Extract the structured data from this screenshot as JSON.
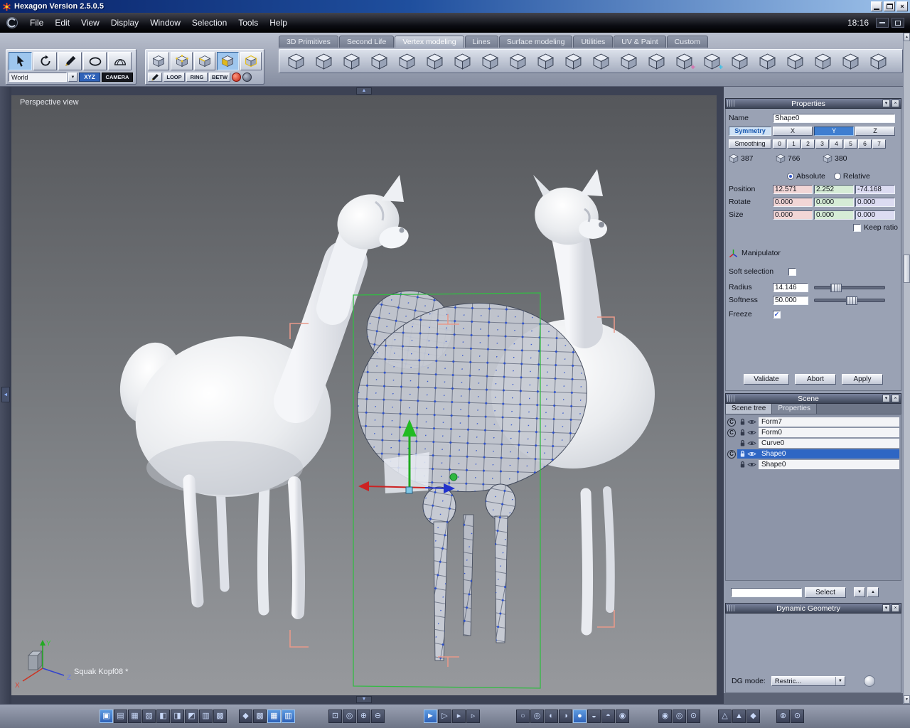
{
  "window": {
    "title": "Hexagon Version 2.5.0.5",
    "clock": "18:16"
  },
  "menu": {
    "items": [
      "File",
      "Edit",
      "View",
      "Display",
      "Window",
      "Selection",
      "Tools",
      "Help"
    ]
  },
  "tabs": {
    "items": [
      "3D Primitives",
      "Second Life",
      "Vertex modeling",
      "Lines",
      "Surface modeling",
      "Utilities",
      "UV & Paint",
      "Custom"
    ],
    "active_index": 2
  },
  "toolbars": {
    "world_selector": "World",
    "xyz_button": "XYZ",
    "camera_button": "CAMERA",
    "loop_button": "LOOP",
    "ring_button": "RING",
    "betw_button": "BETW"
  },
  "viewport": {
    "view_label": "Perspective view",
    "status_text": "Squak Kopf08 *",
    "axis_labels": {
      "x": "X",
      "y": "Y",
      "z": "Z"
    }
  },
  "properties_panel": {
    "title": "Properties",
    "name_label": "Name",
    "name_value": "Shape0",
    "symmetry_button": "Symmetry",
    "axis_buttons": [
      "X",
      "Y",
      "Z"
    ],
    "active_symmetry_axis": "Y",
    "smoothing_button": "Smoothing",
    "smoothing_levels": [
      "0",
      "1",
      "2",
      "3",
      "4",
      "5",
      "6",
      "7"
    ],
    "counts": {
      "vertices": "387",
      "edges": "766",
      "faces": "380"
    },
    "absolute_label": "Absolute",
    "relative_label": "Relative",
    "coordinate_mode": "Absolute",
    "position_label": "Position",
    "position": [
      "12.571",
      "2.252",
      "-74.168"
    ],
    "rotate_label": "Rotate",
    "rotate": [
      "0.000",
      "0.000",
      "0.000"
    ],
    "size_label": "Size",
    "size": [
      "0.000",
      "0.000",
      "0.000"
    ],
    "keep_ratio_label": "Keep ratio",
    "keep_ratio_checked": false,
    "manipulator_label": "Manipulator",
    "soft_selection_label": "Soft selection",
    "soft_selection_checked": false,
    "radius_label": "Radius",
    "radius_value": "14.146",
    "softness_label": "Softness",
    "softness_value": "50.000",
    "freeze_label": "Freeze",
    "freeze_checked": true,
    "validate_button": "Validate",
    "abort_button": "Abort",
    "apply_button": "Apply"
  },
  "scene_panel": {
    "title": "Scene",
    "tabs": [
      "Scene tree",
      "Properties"
    ],
    "active_tab": 0,
    "items": [
      {
        "label": "Form7",
        "dg_badge": true
      },
      {
        "label": "Form0",
        "dg_badge": true
      },
      {
        "label": "Curve0",
        "dg_badge": false
      },
      {
        "label": "Shape0",
        "dg_badge": true
      },
      {
        "label": "Shape0",
        "dg_badge": false
      }
    ],
    "selected_index": 3,
    "filter_value": "",
    "select_button": "Select"
  },
  "dg_panel": {
    "title": "Dynamic Geometry",
    "mode_label": "DG mode:",
    "mode_value": "Restric..."
  },
  "icons": {
    "dropdown_arrow": "▼",
    "up_arrow": "▲",
    "down_arrow": "▼",
    "left_arrow": "◄",
    "panel_shade": "▾",
    "panel_close": "×",
    "window_close": "×",
    "checkmark": "✓",
    "dg_badge": "C"
  },
  "bottom_toolbar": {
    "groups": [
      {
        "name": "viewport-layouts",
        "glyphs": [
          "▣",
          "▤",
          "▦",
          "▧",
          "◧",
          "◨",
          "◩",
          "▥",
          "▩"
        ],
        "selected": [
          0
        ]
      },
      {
        "name": "snap-display",
        "glyphs": [
          "◆",
          "▩",
          "▦",
          "▥"
        ],
        "selected": [
          2,
          3
        ]
      },
      {
        "name": "zoom-tools",
        "glyphs": [
          "⊡",
          "◎",
          "⊕",
          "⊖"
        ],
        "selected": []
      },
      {
        "name": "selection-filters",
        "glyphs": [
          "►",
          "▷",
          "▸",
          "▹"
        ],
        "selected": [
          0
        ]
      },
      {
        "name": "shading-modes",
        "glyphs": [
          "○",
          "◎",
          "◐",
          "◑",
          "●",
          "◒",
          "◓",
          "◉"
        ],
        "selected": [
          4
        ]
      },
      {
        "name": "display-options",
        "glyphs": [
          "◉",
          "◎",
          "⊙"
        ],
        "selected": []
      },
      {
        "name": "culling-modes",
        "glyphs": [
          "△",
          "▲",
          "◆"
        ],
        "selected": []
      },
      {
        "name": "render-tools",
        "glyphs": [
          "⊗",
          "⊙"
        ],
        "selected": []
      }
    ]
  },
  "colors": {
    "selection_highlight": "#2e66c4",
    "axis_x": "#cc3322",
    "axis_y": "#22aa22",
    "axis_z": "#3344cc",
    "field_x_bg": "#f2d6d6",
    "field_y_bg": "#d6ecd6",
    "field_z_bg": "#dcdcf2",
    "bounding_box_green": "#33bb44",
    "marker_salmon": "#e8998a"
  }
}
